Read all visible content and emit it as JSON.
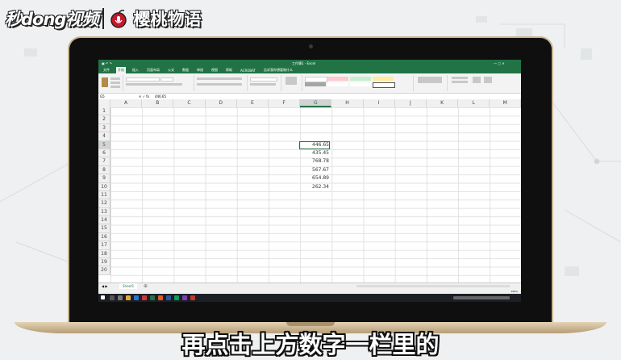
{
  "branding": {
    "logo_left": "秒dong视频",
    "logo_right": "樱桃物语"
  },
  "excel": {
    "title": "工作簿1 - Excel",
    "tabs": [
      "文件",
      "开始",
      "插入",
      "页面布局",
      "公式",
      "数据",
      "审阅",
      "视图",
      "帮助",
      "ACROBAT",
      "告诉我你想要做什么"
    ],
    "active_tab": "开始",
    "name_box": "G5",
    "formula_value": "446.65",
    "columns": [
      "A",
      "B",
      "C",
      "D",
      "E",
      "F",
      "G",
      "H",
      "I",
      "J",
      "K",
      "L",
      "M"
    ],
    "selected_column": "G",
    "rows": [
      "1",
      "2",
      "3",
      "4",
      "5",
      "6",
      "7",
      "8",
      "9",
      "10",
      "11",
      "12",
      "13",
      "14",
      "15",
      "16",
      "17",
      "18",
      "19",
      "20"
    ],
    "selected_row": "5",
    "values": [
      "446.65",
      "435.45",
      "768.78",
      "567.67",
      "654.89",
      "262.34"
    ],
    "sheet_tab": "Sheet1",
    "zoom": "100%"
  },
  "subtitle": "再点击上方数字一栏里的",
  "colors": {
    "excel_green": "#217346",
    "taskbar": "#1d1f26"
  }
}
